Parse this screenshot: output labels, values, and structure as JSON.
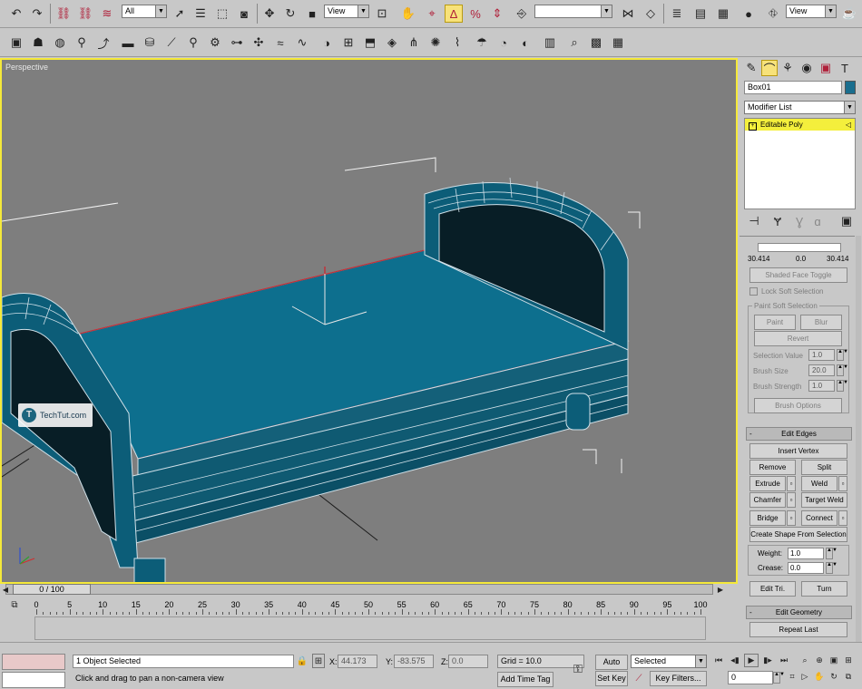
{
  "main_toolbar": {
    "selection_filter": "All",
    "ref_coord": "View",
    "named_selection": "",
    "render_view": "View"
  },
  "viewport": {
    "label": "Perspective",
    "watermark": "TechTut.com"
  },
  "command_panel": {
    "object_name": "Box01",
    "object_color": "#1a6e8e",
    "modifier_list": "Modifier List",
    "stack_item": "Editable Poly",
    "soft_sel": {
      "curve_left": "30.414",
      "curve_mid": "0.0",
      "curve_right": "30.414",
      "shaded_face_toggle": "Shaded Face Toggle",
      "lock_soft_selection": "Lock Soft Selection",
      "paint_group": "Paint Soft Selection",
      "paint": "Paint",
      "blur": "Blur",
      "revert": "Revert",
      "selection_value_label": "Selection Value",
      "selection_value": "1.0",
      "brush_size_label": "Brush Size",
      "brush_size": "20.0",
      "brush_strength_label": "Brush Strength",
      "brush_strength": "1.0",
      "brush_options": "Brush Options"
    },
    "edit_edges": {
      "title": "Edit Edges",
      "toggle": "-",
      "insert_vertex": "Insert Vertex",
      "remove": "Remove",
      "split": "Split",
      "extrude": "Extrude",
      "weld": "Weld",
      "chamfer": "Chamfer",
      "target_weld": "Target Weld",
      "bridge": "Bridge",
      "connect": "Connect",
      "create_shape": "Create Shape From Selection",
      "weight_label": "Weight:",
      "weight": "1.0",
      "crease_label": "Crease:",
      "crease": "0.0",
      "edit_tri": "Edit Tri.",
      "turn": "Turn"
    },
    "edit_geometry": {
      "title": "Edit Geometry",
      "toggle": "-",
      "repeat_last": "Repeat Last"
    }
  },
  "timeline": {
    "slider": "0 / 100",
    "ticks": [
      "0",
      "5",
      "10",
      "15",
      "20",
      "25",
      "30",
      "35",
      "40",
      "45",
      "50",
      "55",
      "60",
      "65",
      "70",
      "75",
      "80",
      "85",
      "90",
      "95",
      "100"
    ]
  },
  "status_bar": {
    "selection": "1 Object Selected",
    "prompt": "Click and drag to pan a non-camera view",
    "x_label": "X:",
    "x": "44.173",
    "y_label": "Y:",
    "y": "-83.575",
    "z_label": "Z:",
    "z": "0.0",
    "grid": "Grid = 10.0",
    "add_time_tag": "Add Time Tag",
    "auto_key": "Auto Key",
    "set_key": "Set Key",
    "key_mode": "Selected",
    "key_filters": "Key Filters...",
    "frame": "0"
  }
}
